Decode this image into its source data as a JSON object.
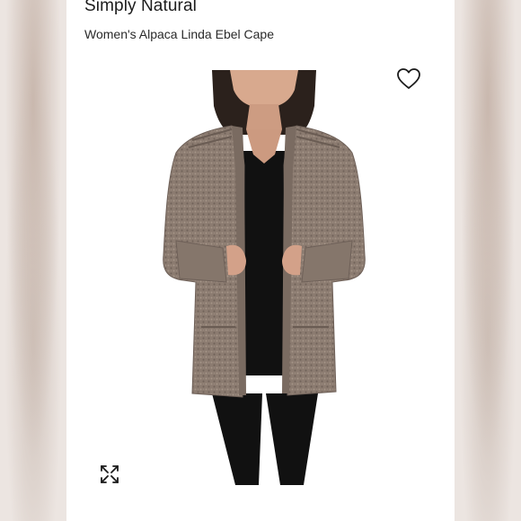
{
  "listing": {
    "brand": "Simply Natural",
    "title": "Women's Alpaca Linda Ebel Cape"
  },
  "icons": {
    "favorite": "heart-icon",
    "expand": "expand-icon"
  },
  "colors": {
    "text": "#1c1c1c",
    "sweater": "#8c7c70",
    "sweater_dark": "#6e6058",
    "black_clothing": "#111111"
  }
}
